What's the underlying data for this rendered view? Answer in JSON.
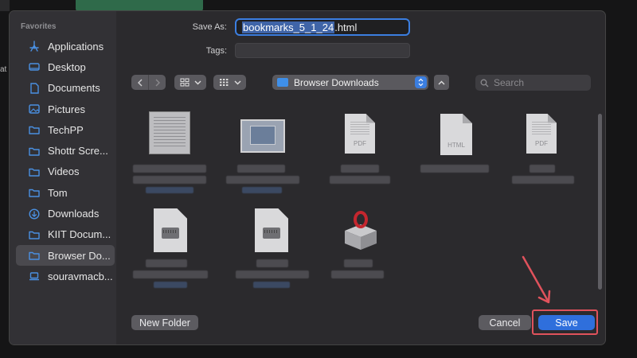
{
  "dialog": {
    "save_as_label": "Save As:",
    "filename_selected": "bookmarks_5_1_24",
    "filename_ext": ".html",
    "tags_label": "Tags:",
    "tags_value": ""
  },
  "sidebar": {
    "heading": "Favorites",
    "items": [
      {
        "label": "Applications",
        "icon": "applications-icon"
      },
      {
        "label": "Desktop",
        "icon": "desktop-icon"
      },
      {
        "label": "Documents",
        "icon": "document-icon"
      },
      {
        "label": "Pictures",
        "icon": "pictures-icon"
      },
      {
        "label": "TechPP",
        "icon": "folder-icon"
      },
      {
        "label": "Shottr Scre...",
        "icon": "folder-icon"
      },
      {
        "label": "Videos",
        "icon": "folder-icon"
      },
      {
        "label": "Tom",
        "icon": "folder-icon"
      },
      {
        "label": "Downloads",
        "icon": "downloads-icon"
      },
      {
        "label": "KIIT Docum...",
        "icon": "folder-icon"
      },
      {
        "label": "Browser Do...",
        "icon": "folder-icon",
        "active": true
      },
      {
        "label": "souravmacb...",
        "icon": "laptop-icon"
      }
    ]
  },
  "toolbar": {
    "location": "Browser Downloads",
    "search_placeholder": "Search"
  },
  "files": [
    {
      "kind": "document-thumbnail"
    },
    {
      "kind": "screenshot-thumbnail"
    },
    {
      "kind": "file",
      "ext": "PDF"
    },
    {
      "kind": "file",
      "ext": "HTML"
    },
    {
      "kind": "file",
      "ext": "PDF"
    },
    {
      "kind": "disk-image"
    },
    {
      "kind": "disk-image"
    },
    {
      "kind": "package"
    }
  ],
  "footer": {
    "new_folder": "New Folder",
    "cancel": "Cancel",
    "save": "Save"
  },
  "colors": {
    "accent": "#2f6fdc",
    "annotation": "#e0525c",
    "sheet_bg": "#2b2a2d",
    "sidebar_bg": "#323135"
  }
}
